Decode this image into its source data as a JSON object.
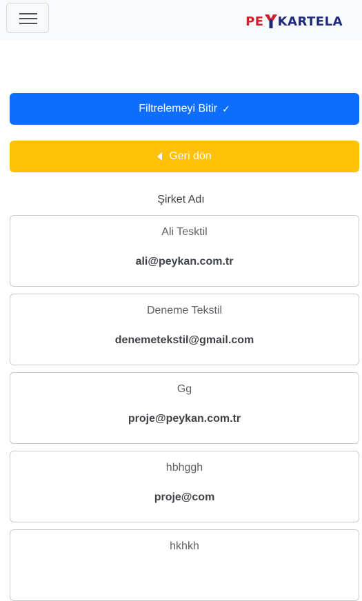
{
  "header": {
    "menu_icon": "hamburger-menu-icon",
    "logo_prefix": "PE",
    "logo_suffix": "KARTELA",
    "logo_colors": {
      "red": "#d4202a",
      "navy": "#1f2a7a"
    }
  },
  "actions": {
    "finish_filter_label": "Filtrelemeyi Bitir",
    "finish_filter_icon": "check-icon",
    "back_label": "Geri dön",
    "back_icon": "caret-left-icon"
  },
  "list": {
    "column_label": "Şirket Adı",
    "items": [
      {
        "name": "Ali Tesktil",
        "email": "ali@peykan.com.tr"
      },
      {
        "name": "Deneme Tekstil",
        "email": "denemetekstil@gmail.com"
      },
      {
        "name": "Gg",
        "email": "proje@peykan.com.tr"
      },
      {
        "name": "hbhggh",
        "email": "proje@com"
      },
      {
        "name": "hkhkh",
        "email": ""
      }
    ]
  },
  "colors": {
    "primary": "#0d6efd",
    "warning": "#ffc107"
  }
}
